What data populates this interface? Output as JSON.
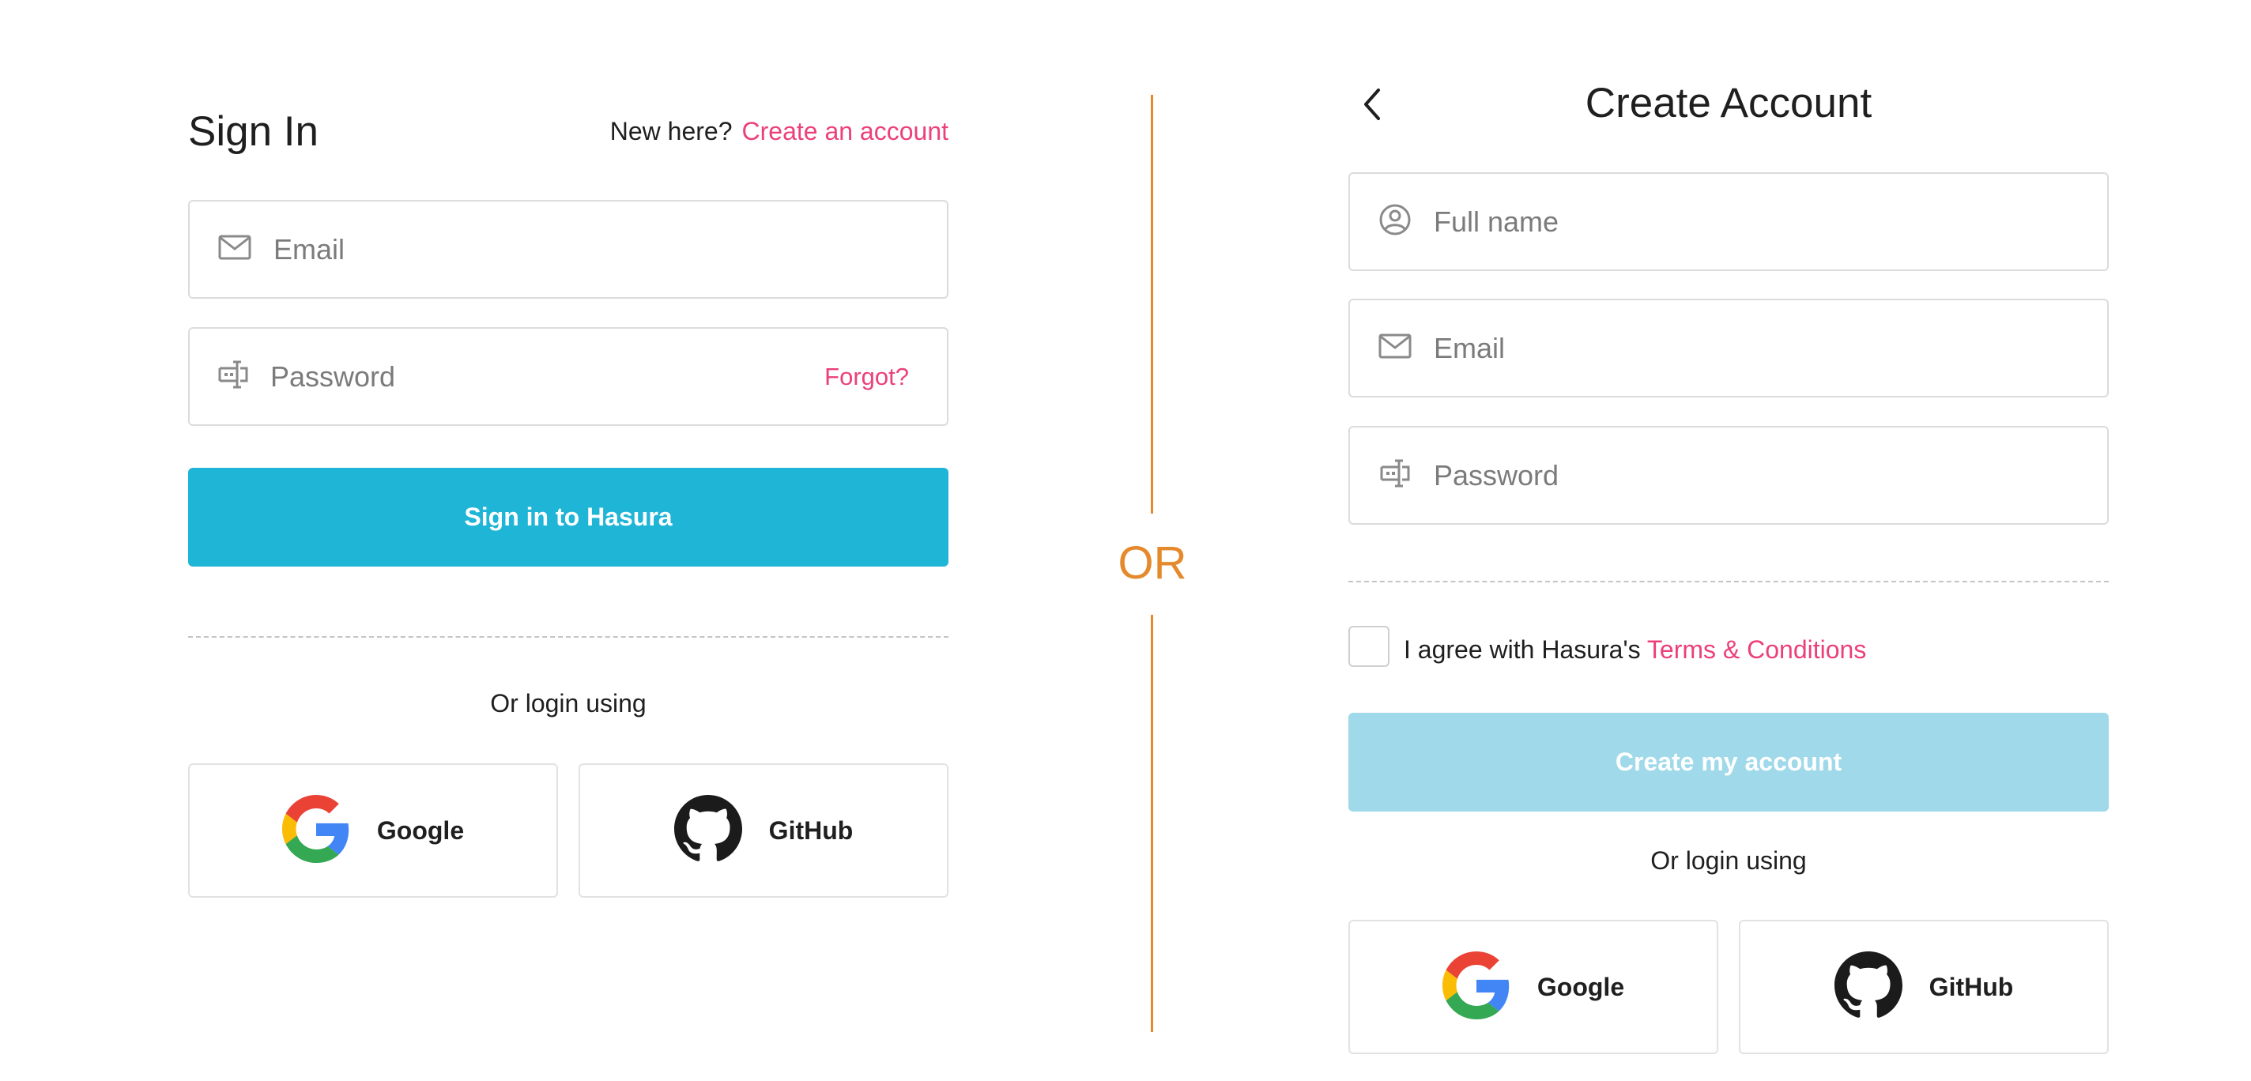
{
  "signin": {
    "title": "Sign In",
    "new_here": "New here?",
    "create_link": "Create an account",
    "email_placeholder": "Email",
    "password_placeholder": "Password",
    "forgot": "Forgot?",
    "submit": "Sign in to Hasura",
    "or_login": "Or login using",
    "google": "Google",
    "github": "GitHub"
  },
  "divider": {
    "label": "OR"
  },
  "signup": {
    "title": "Create Account",
    "fullname_placeholder": "Full name",
    "email_placeholder": "Email",
    "password_placeholder": "Password",
    "agree_text": "I agree with Hasura's",
    "terms_link": "Terms & Conditions",
    "submit": "Create my account",
    "or_login": "Or login using",
    "google": "Google",
    "github": "GitHub"
  },
  "colors": {
    "accent_link": "#ec407a",
    "primary_button": "#1fb5d6",
    "disabled_button": "#9fd9ea",
    "divider": "#e58a2c"
  },
  "icons": {
    "back": "chevron-left-icon",
    "email": "mail-icon",
    "password": "password-cursor-icon",
    "fullname": "user-circle-icon",
    "google": "google-logo-icon",
    "github": "github-logo-icon"
  }
}
